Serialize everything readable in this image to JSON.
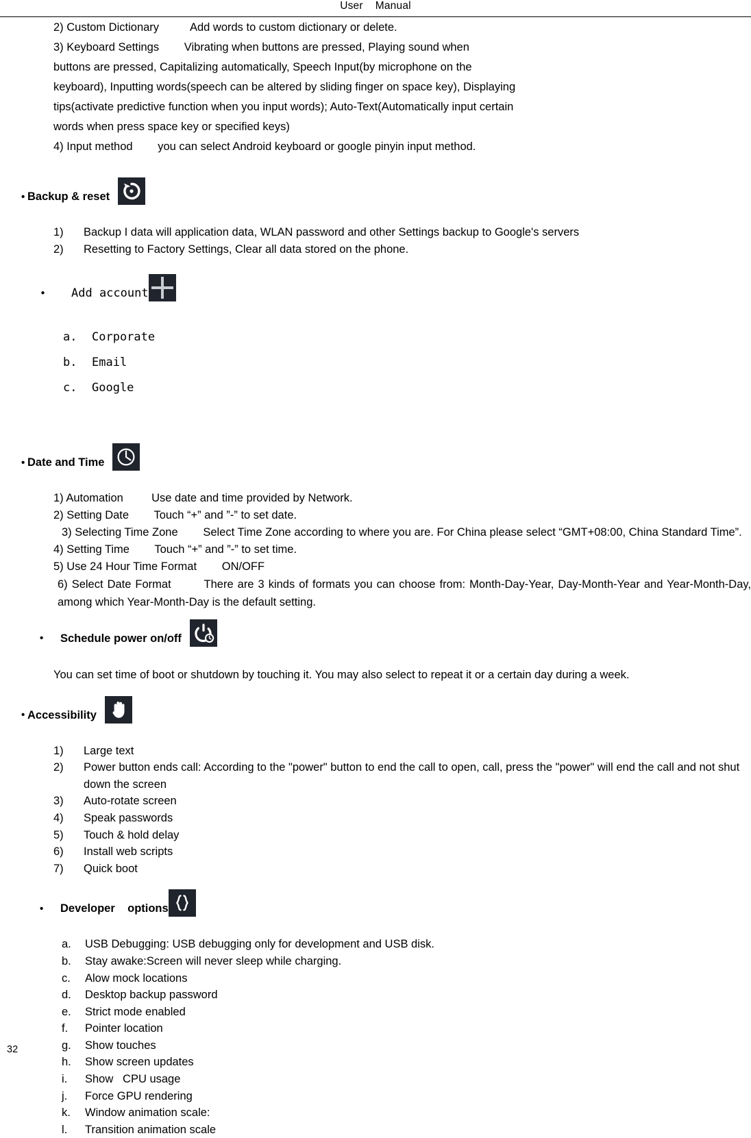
{
  "header": {
    "title": "User    Manual"
  },
  "page_number": "32",
  "intro": {
    "lines": [
      "2) Custom Dictionary          Add words to custom dictionary or delete.",
      "3) Keyboard Settings        Vibrating when buttons are pressed, Playing sound when",
      "buttons are pressed, Capitalizing automatically, Speech Input(by microphone on the",
      "keyboard), Inputting words(speech can be altered by sliding finger on space key), Displaying",
      "tips(activate predictive function when you input words); Auto-Text(Automatically input certain",
      "words when press space key or specified keys)",
      "4) Input method        you can select Android keyboard or google pinyin input method."
    ]
  },
  "sections": {
    "backup_reset": {
      "bullet": "•",
      "title": "Backup & reset",
      "icon": "restore-backup-icon",
      "items": [
        {
          "marker": "1)",
          "text": "Backup I data will application data, WLAN password and other Settings backup to Google's servers"
        },
        {
          "marker": "2)",
          "text": "Resetting to Factory Settings, Clear all data stored on the phone."
        }
      ]
    },
    "add_account": {
      "bullet": "•",
      "title": "Add account",
      "icon": "plus-icon",
      "items": [
        {
          "marker": "a.",
          "text": "Corporate"
        },
        {
          "marker": "b.",
          "text": "Email"
        },
        {
          "marker": "c.",
          "text": "Google"
        }
      ]
    },
    "date_time": {
      "bullet": "•",
      "title": "Date and Time",
      "icon": "clock-icon",
      "lines": [
        "1) Automation         Use date and time provided by Network.",
        "2) Setting Date        Touch “+” and ”-” to set date.",
        "3) Selecting Time Zone        Select Time Zone according to where you are. For China please select “GMT+08:00, China Standard Time”.",
        "4) Setting Time        Touch “+” and ”-” to set time.",
        "5) Use 24 Hour Time Format        ON/OFF",
        "6) Select Date Format        There are 3 kinds of formats you can choose from: Month-Day-Year, Day-Month-Year and Year-Month-Day, among which Year-Month-Day is the default setting."
      ]
    },
    "schedule_power": {
      "bullet": "•",
      "title": "Schedule power on/off",
      "icon": "power-clock-icon",
      "body": "You can set time of boot or shutdown by touching it. You may also select to repeat it or a certain day during a week."
    },
    "accessibility": {
      "bullet": "•",
      "title": "Accessibility",
      "icon": "hand-icon",
      "items": [
        {
          "marker": "1)",
          "text": "Large text"
        },
        {
          "marker": "2)",
          "text": "Power button ends call: According to the \"power\" button to end the call to open, call, press the \"power\" will end the call and not shut down the screen"
        },
        {
          "marker": "3)",
          "text": "Auto-rotate screen"
        },
        {
          "marker": "4)",
          "text": "Speak passwords"
        },
        {
          "marker": "5)",
          "text": "Touch & hold delay"
        },
        {
          "marker": "6)",
          "text": "Install web scripts"
        },
        {
          "marker": "7)",
          "text": "Quick boot"
        }
      ]
    },
    "developer_options": {
      "bullet": "•",
      "title": "Developer    options",
      "icon": "curly-braces-icon",
      "items": [
        {
          "marker": "a.",
          "text": "USB Debugging: USB debugging only for development and USB disk."
        },
        {
          "marker": "b.",
          "text": "Stay awake:Screen will never sleep while charging."
        },
        {
          "marker": "c.",
          "text": "Alow mock locations"
        },
        {
          "marker": "d.",
          "text": "Desktop backup password"
        },
        {
          "marker": "e.",
          "text": "Strict mode enabled"
        },
        {
          "marker": "f.",
          "text": "Pointer location"
        },
        {
          "marker": "g.",
          "text": "Show touches"
        },
        {
          "marker": "h.",
          "text": "Show screen updates"
        },
        {
          "marker": "i.",
          "text": "Show   CPU usage"
        },
        {
          "marker": "j.",
          "text": "Force GPU rendering"
        },
        {
          "marker": "k.",
          "text": "Window animation scale:"
        },
        {
          "marker": "l.",
          "text": "Transition animation scale"
        }
      ]
    }
  },
  "colors": {
    "icon_tile_bg": "#20242c",
    "icon_glyph": "#ffffff",
    "text": "#000000"
  }
}
